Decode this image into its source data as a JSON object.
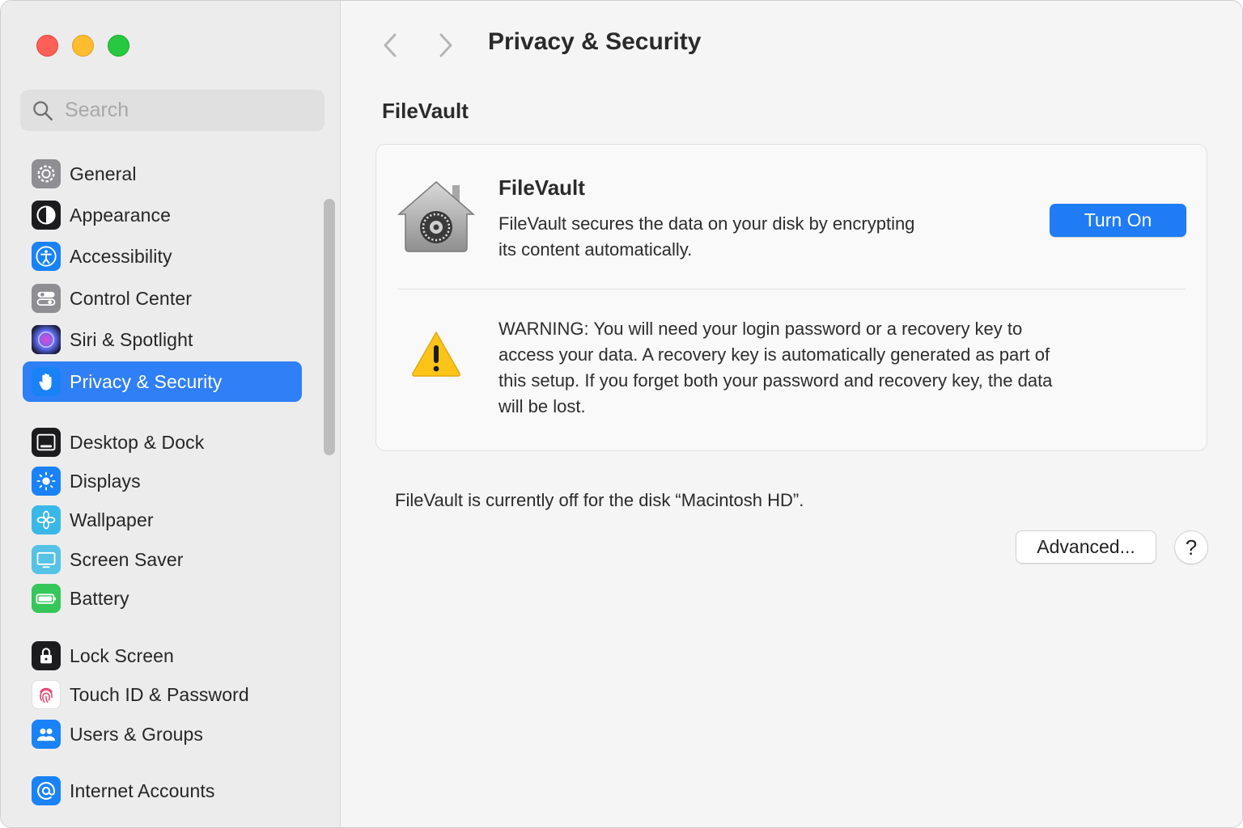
{
  "sidebar": {
    "search": {
      "placeholder": "Search",
      "value": ""
    },
    "items": [
      {
        "label": "General",
        "icon": "gear-icon",
        "color": "#8e8e93"
      },
      {
        "label": "Appearance",
        "icon": "appearance-icon",
        "color": "#1c1c1e"
      },
      {
        "label": "Accessibility",
        "icon": "accessibility-icon",
        "color": "#1a82f7"
      },
      {
        "label": "Control Center",
        "icon": "control-center-icon",
        "color": "#8e8e93"
      },
      {
        "label": "Siri & Spotlight",
        "icon": "siri-icon",
        "color": "#2b2b5e"
      },
      {
        "label": "Privacy & Security",
        "icon": "hand-icon",
        "color": "#1a82f7",
        "active": true
      },
      {
        "label": "Desktop & Dock",
        "icon": "desktop-dock-icon",
        "color": "#1c1c1e"
      },
      {
        "label": "Displays",
        "icon": "displays-icon",
        "color": "#1a82f7"
      },
      {
        "label": "Wallpaper",
        "icon": "wallpaper-icon",
        "color": "#39b8e8"
      },
      {
        "label": "Screen Saver",
        "icon": "screen-saver-icon",
        "color": "#55c2e6"
      },
      {
        "label": "Battery",
        "icon": "battery-icon",
        "color": "#35c759"
      },
      {
        "label": "Lock Screen",
        "icon": "lock-icon",
        "color": "#1c1c1e"
      },
      {
        "label": "Touch ID & Password",
        "icon": "fingerprint-icon",
        "color": "#ffffff"
      },
      {
        "label": "Users & Groups",
        "icon": "users-icon",
        "color": "#1a82f7"
      },
      {
        "label": "Internet Accounts",
        "icon": "at-icon",
        "color": "#1a82f7"
      }
    ]
  },
  "header": {
    "title": "Privacy & Security"
  },
  "section": {
    "title": "FileVault"
  },
  "filevault": {
    "title": "FileVault",
    "description": "FileVault secures the data on your disk by encrypting its content automatically.",
    "button": "Turn On",
    "warning": "WARNING: You will need your login password or a recovery key to access your data. A recovery key is automatically generated as part of this setup. If you forget both your password and recovery key, the data will be lost.",
    "status": "FileVault is currently off for the disk “Macintosh HD”."
  },
  "actions": {
    "advanced": "Advanced...",
    "help": "?"
  },
  "colors": {
    "accent": "#2f7ff6",
    "sidebar_bg": "#ececec",
    "content_bg": "#f5f5f5"
  }
}
